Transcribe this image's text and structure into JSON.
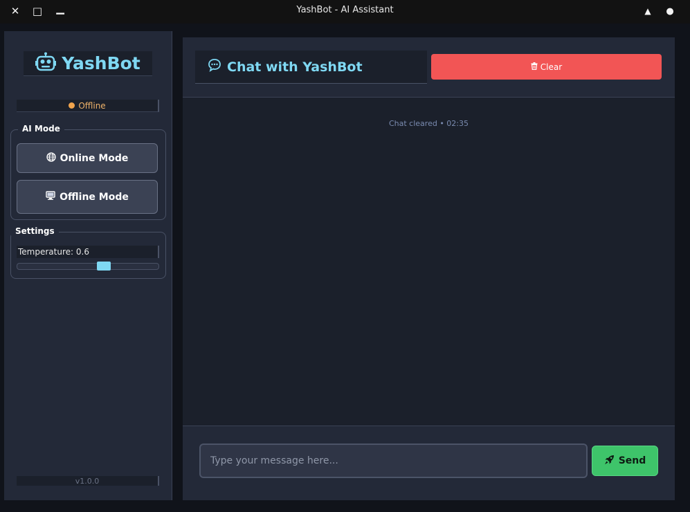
{
  "window": {
    "title": "YashBot - AI Assistant",
    "close_glyph": "✕",
    "maximize_glyph": "□",
    "minimize_glyph": "▁",
    "up_glyph": "▲",
    "dot_glyph": "●"
  },
  "sidebar": {
    "logo_icon": "robot-icon",
    "logo_text": "YashBot",
    "status": {
      "text": "Offline",
      "color": "#f0a44d"
    },
    "ai_mode": {
      "title": "AI Mode",
      "online_label": "Online Mode",
      "offline_label": "Offline Mode"
    },
    "settings": {
      "title": "Settings",
      "temperature_label": "Temperature: 0.6",
      "temperature_value": 0.6
    },
    "version": "v1.0.0"
  },
  "chat": {
    "title": "Chat with YashBot",
    "clear_label": "Clear",
    "messages": [
      {
        "type": "system",
        "text": "Chat cleared • 02:35"
      }
    ],
    "input_placeholder": "Type your message here...",
    "send_label": "Send"
  },
  "colors": {
    "accent": "#7fd8f3",
    "danger": "#f25555",
    "success": "#3ec46a"
  }
}
